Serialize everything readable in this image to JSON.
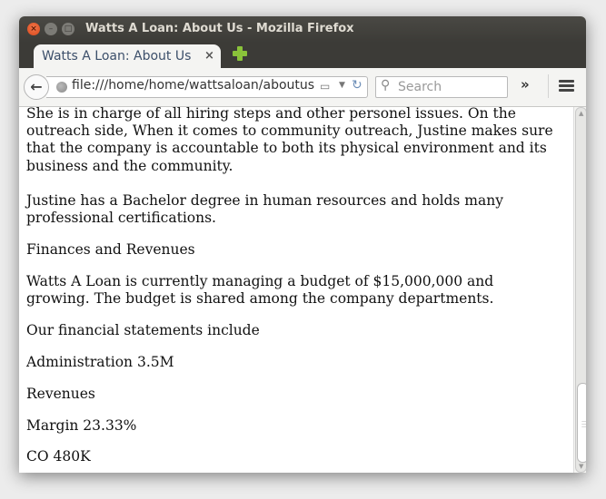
{
  "window": {
    "title": "Watts A Loan: About Us - Mozilla Firefox",
    "close_glyph": "×",
    "min_glyph": "–",
    "max_glyph": "□"
  },
  "tabs": [
    {
      "label": "Watts A Loan: About Us",
      "close_glyph": "×",
      "active": true
    }
  ],
  "navbar": {
    "back_glyph": "←",
    "url": "file:///home/home/wattsaloan/aboutus",
    "reader_glyph": "▭",
    "dropdown_glyph": "▼",
    "reload_glyph": "↻",
    "search_placeholder": "Search",
    "search_glyph": "⚲",
    "overflow_glyph": "»"
  },
  "content": {
    "paragraphs": [
      "She is in charge of all hiring steps and other personel issues. On the outreach side, When it comes to community outreach, Justine makes sure that the company is accountable to both its physical environment and its business and the community.",
      "Justine has a Bachelor degree in human resources and holds many professional certifications.",
      "Finances and Revenues",
      "Watts A Loan is currently managing a budget of $15,000,000 and growing. The budget is shared among the company departments.",
      "Our financial statements include",
      "Administration 3.5M",
      "Revenues",
      "Margin 23.33%",
      "CO 480K"
    ]
  }
}
